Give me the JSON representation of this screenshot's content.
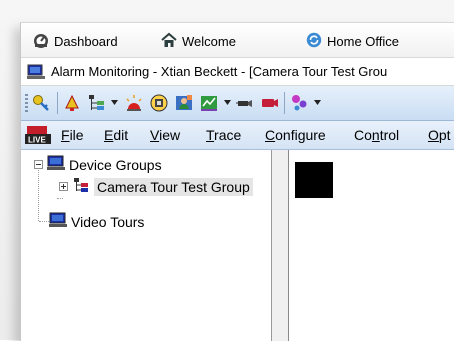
{
  "nav": {
    "items": [
      {
        "label": "Dashboard",
        "icon": "dashboard-icon"
      },
      {
        "label": "Welcome",
        "icon": "home-icon"
      },
      {
        "label": "Home Office",
        "icon": "sync-icon"
      }
    ]
  },
  "window": {
    "title": "Alarm Monitoring - Xtian Beckett - [Camera Tour Test Grou"
  },
  "menu": {
    "items": [
      {
        "label": "File",
        "mnemonic": "F",
        "rest": "ile"
      },
      {
        "label": "Edit",
        "mnemonic": "E",
        "rest": "dit"
      },
      {
        "label": "View",
        "mnemonic": "V",
        "rest": "iew"
      },
      {
        "label": "Trace",
        "mnemonic": "T",
        "rest": "race"
      },
      {
        "label": "Configure",
        "mnemonic": "C",
        "rest": "onfigure"
      },
      {
        "label": "Control",
        "pre": "Co",
        "mnemonic": "n",
        "rest": "trol"
      },
      {
        "label": "Opt",
        "mnemonic": "O",
        "rest": "pt"
      }
    ]
  },
  "tree": {
    "root": {
      "label": "Device Groups",
      "icon": "monitor-icon"
    },
    "child": {
      "label": "Camera Tour Test Group",
      "icon": "network-group-icon"
    },
    "sibling": {
      "label": "Video Tours",
      "icon": "monitor-icon"
    }
  },
  "colors": {
    "toolbar_top": "#e6f0fb",
    "toolbar_bottom": "#c9ddf3",
    "selection": "#e5e5e5"
  }
}
